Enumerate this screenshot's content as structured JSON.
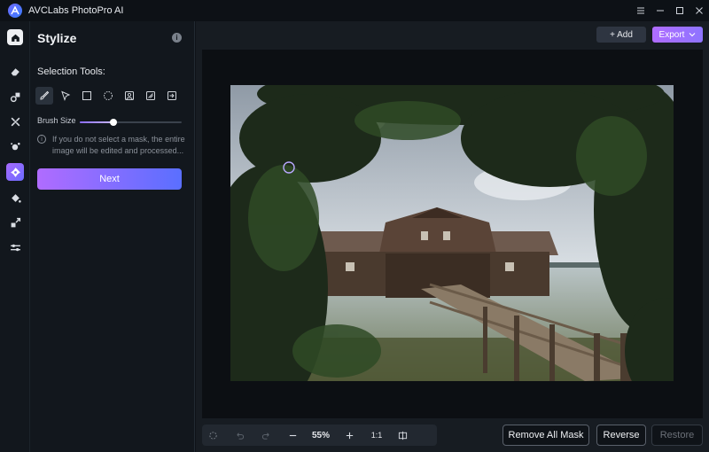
{
  "app": {
    "title": "AVCLabs PhotoPro AI"
  },
  "window_controls": [
    "menu-icon",
    "minimize-icon",
    "maximize-icon",
    "close-icon"
  ],
  "rail": {
    "items": [
      "home-icon",
      "eraser-icon",
      "replace-icon",
      "enhance-icon",
      "colorize-icon",
      "stylize-icon",
      "fill-icon",
      "resize-icon",
      "adjust-icon"
    ],
    "active": "stylize-icon"
  },
  "panel": {
    "title": "Stylize",
    "selection_label": "Selection Tools:",
    "tools": [
      "brush-icon",
      "lasso-icon",
      "rectangle-icon",
      "ellipse-icon",
      "portrait-select-icon",
      "object-select-icon",
      "import-mask-icon"
    ],
    "brush_size_label": "Brush Size",
    "brush_size_fraction": 0.33,
    "note_line1": "If you do not select a mask, the entire",
    "note_line2": "image will be edited and processed...",
    "next_label": "Next"
  },
  "toolbar": {
    "add_label": "+ Add",
    "export_label": "Export"
  },
  "zoom": {
    "value": "55%",
    "ratio": "1:1"
  },
  "actions": {
    "remove_mask": "Remove All Mask",
    "reverse": "Reverse",
    "restore": "Restore"
  },
  "colors": {
    "accent_start": "#b06cff",
    "accent_end": "#5a6fff",
    "background": "#0f1318",
    "panel": "#12171d"
  }
}
